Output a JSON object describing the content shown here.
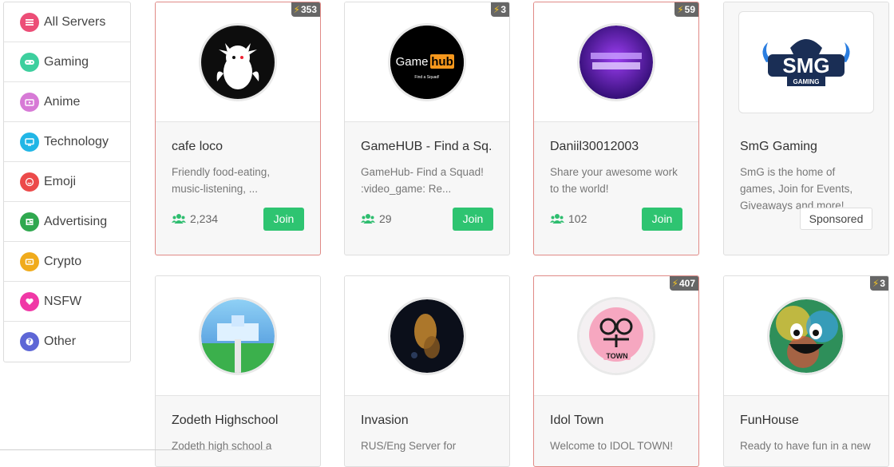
{
  "sidebar": {
    "items": [
      {
        "label": "All Servers",
        "color": "#ec4e77",
        "icon": "list-icon"
      },
      {
        "label": "Gaming",
        "color": "#3dcf9e",
        "icon": "gamepad-icon"
      },
      {
        "label": "Anime",
        "color": "#d77ad6",
        "icon": "tv-icon"
      },
      {
        "label": "Technology",
        "color": "#21b6e6",
        "icon": "monitor-icon"
      },
      {
        "label": "Emoji",
        "color": "#ec4a4a",
        "icon": "smile-icon"
      },
      {
        "label": "Advertising",
        "color": "#2fa84f",
        "icon": "newspaper-icon"
      },
      {
        "label": "Crypto",
        "color": "#f0ab1c",
        "icon": "coin-icon"
      },
      {
        "label": "NSFW",
        "color": "#f038a6",
        "icon": "heart-icon"
      },
      {
        "label": "Other",
        "color": "#5d66d6",
        "icon": "question-icon"
      }
    ]
  },
  "servers": [
    {
      "name": "cafe loco",
      "desc": "Friendly food-eating, music-listening, ...",
      "members": "2,234",
      "badge": "353",
      "action": "Join"
    },
    {
      "name": "GameHUB - Find a Sq...",
      "desc": "GameHub- Find a Squad! :video_game: Re...",
      "members": "29",
      "badge": "3",
      "action": "Join",
      "logo_text_a": "Game",
      "logo_text_b": "hub",
      "logo_sub": "Find a Squad!"
    },
    {
      "name": "Daniil30012003",
      "desc": "Share your awesome work to the world!",
      "members": "102",
      "badge": "59",
      "action": "Join"
    },
    {
      "name": "SmG Gaming",
      "desc": "SmG is the home of games, Join for Events, Giveaways and more!",
      "action": "Sponsored",
      "logo_text": "SMG",
      "logo_sub": "GAMING"
    },
    {
      "name": "Zodeth Highschool",
      "desc": "Zodeth high school a"
    },
    {
      "name": "Invasion",
      "desc": "RUS/Eng Server for"
    },
    {
      "name": "Idol Town",
      "desc": "Welcome to IDOL TOWN!",
      "badge": "407",
      "logo_text": "TOWN"
    },
    {
      "name": "FunHouse",
      "desc": "Ready to have fun in a new",
      "badge": "3"
    }
  ]
}
